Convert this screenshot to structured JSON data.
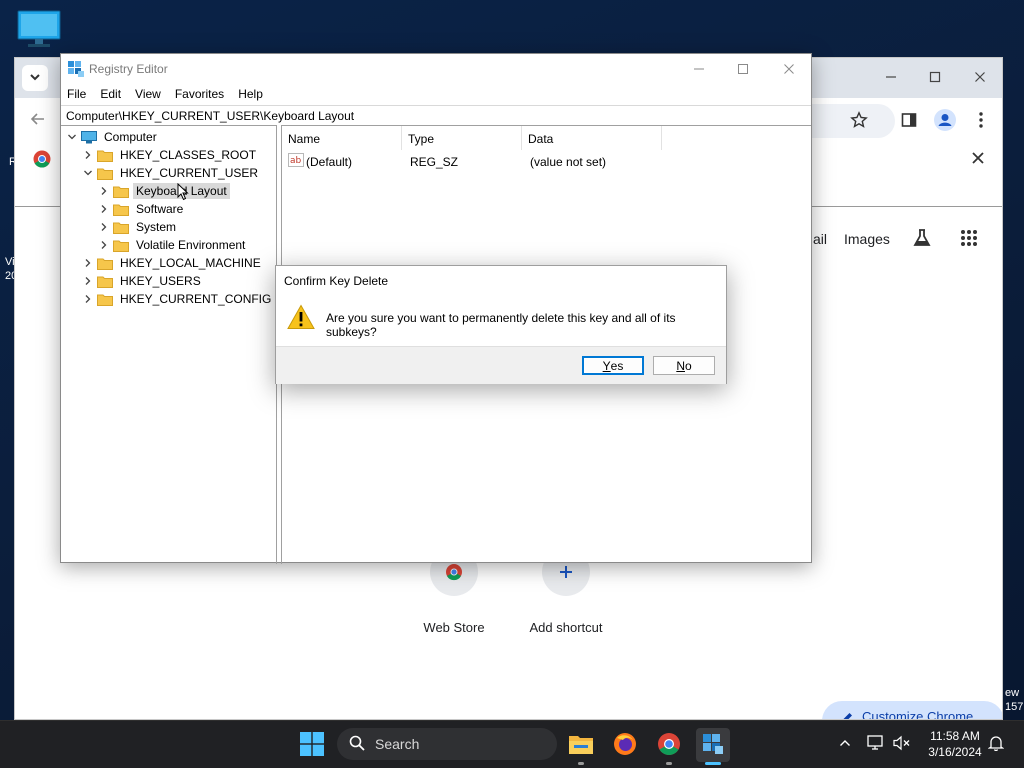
{
  "desktop": {
    "icon": "this-pc-icon",
    "left_edge_text": [
      "R",
      "Vi",
      "20"
    ],
    "right_edge_text": [
      "ew",
      "157"
    ]
  },
  "chrome": {
    "controls": [
      "minimize-icon",
      "maximize-icon",
      "close-icon"
    ],
    "ntp_links": [
      "ail",
      "Images"
    ],
    "shortcuts": [
      {
        "label": "Web Store",
        "icon": "chrome-web-store-icon"
      },
      {
        "label": "Add shortcut",
        "icon": "plus-icon"
      }
    ],
    "customize_label": "Customize Chrome"
  },
  "regedit": {
    "title": "Registry Editor",
    "menu": [
      "File",
      "Edit",
      "View",
      "Favorites",
      "Help"
    ],
    "address": "Computer\\HKEY_CURRENT_USER\\Keyboard Layout",
    "tree": [
      {
        "label": "Computer",
        "level": 0,
        "expander": "expanded",
        "icon": "computer"
      },
      {
        "label": "HKEY_CLASSES_ROOT",
        "level": 1,
        "expander": "collapsed",
        "icon": "folder"
      },
      {
        "label": "HKEY_CURRENT_USER",
        "level": 1,
        "expander": "expanded",
        "icon": "folder"
      },
      {
        "label": "Keyboard Layout",
        "level": 2,
        "expander": "collapsed",
        "icon": "folder",
        "selected": true
      },
      {
        "label": "Software",
        "level": 2,
        "expander": "collapsed",
        "icon": "folder"
      },
      {
        "label": "System",
        "level": 2,
        "expander": "collapsed",
        "icon": "folder"
      },
      {
        "label": "Volatile Environment",
        "level": 2,
        "expander": "collapsed",
        "icon": "folder"
      },
      {
        "label": "HKEY_LOCAL_MACHINE",
        "level": 1,
        "expander": "collapsed",
        "icon": "folder"
      },
      {
        "label": "HKEY_USERS",
        "level": 1,
        "expander": "collapsed",
        "icon": "folder"
      },
      {
        "label": "HKEY_CURRENT_CONFIG",
        "level": 1,
        "expander": "collapsed",
        "icon": "folder"
      }
    ],
    "columns": {
      "name": "Name",
      "type": "Type",
      "data": "Data"
    },
    "values": [
      {
        "name": "(Default)",
        "type": "REG_SZ",
        "data": "(value not set)",
        "icon": "string-value-icon"
      }
    ]
  },
  "dialog": {
    "title": "Confirm Key Delete",
    "message": "Are you sure you want to permanently delete this key and all of its subkeys?",
    "icon": "warning-icon",
    "yes": {
      "mnemonic": "Y",
      "rest": "es"
    },
    "no": {
      "mnemonic": "N",
      "rest": "o"
    },
    "default_button": "yes"
  },
  "taskbar": {
    "search_label": "Search",
    "apps": [
      "file-explorer-icon",
      "firefox-icon",
      "chrome-icon",
      "registry-editor-icon"
    ],
    "active_app": "registry-editor-icon",
    "clock_time": "11:58 AM",
    "clock_date": "3/16/2024"
  },
  "colors": {
    "accent": "#0078d4",
    "folder": "#f6c64b",
    "taskbar": "#202124",
    "desktop": "#0b1f3f",
    "warning": "#f7c21b"
  }
}
